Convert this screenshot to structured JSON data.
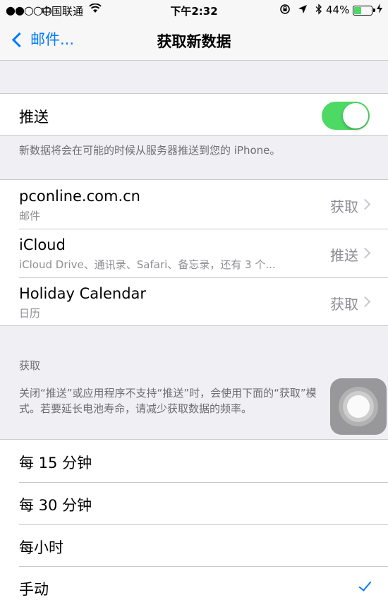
{
  "status_bar": {
    "signal": "●●○○○",
    "carrier": "中国联通",
    "time": "下午2:32",
    "battery_percent": "44%",
    "battery_level": 0.44,
    "battery_color": "#4cd964"
  },
  "nav": {
    "back_label": "邮件...",
    "title": "获取新数据"
  },
  "push": {
    "label": "推送",
    "enabled": true,
    "footer": "新数据将会在可能的时候从服务器推送到您的 iPhone。"
  },
  "accounts": [
    {
      "name": "pconline.com.cn",
      "detail": "邮件",
      "mode": "获取"
    },
    {
      "name": "iCloud",
      "detail": "iCloud Drive、通讯录、Safari、备忘录，还有 3 个...",
      "mode": "推送"
    },
    {
      "name": "Holiday Calendar",
      "detail": "日历",
      "mode": "获取"
    }
  ],
  "fetch": {
    "header": "获取",
    "description_line1": "关闭“推送”或应用程序不支持“推送”时，会使用下面的“获取”模",
    "description_line2": "式。若要延长电池寿命，请减少获取数据的频率。",
    "options": [
      {
        "label": "每 15 分钟",
        "selected": false
      },
      {
        "label": "每 30 分钟",
        "selected": false
      },
      {
        "label": "每小时",
        "selected": false
      },
      {
        "label": "手动",
        "selected": true
      }
    ]
  },
  "colors": {
    "accent": "#007aff",
    "toggle_on": "#4cd964"
  },
  "icons": {
    "back": "chevron-left-icon",
    "disclosure": "chevron-right-icon",
    "checkmark": "checkmark-icon",
    "wifi": "wifi-icon",
    "location": "location-arrow-icon",
    "bluetooth": "bluetooth-icon",
    "lock_rotation": "rotation-lock-icon"
  }
}
